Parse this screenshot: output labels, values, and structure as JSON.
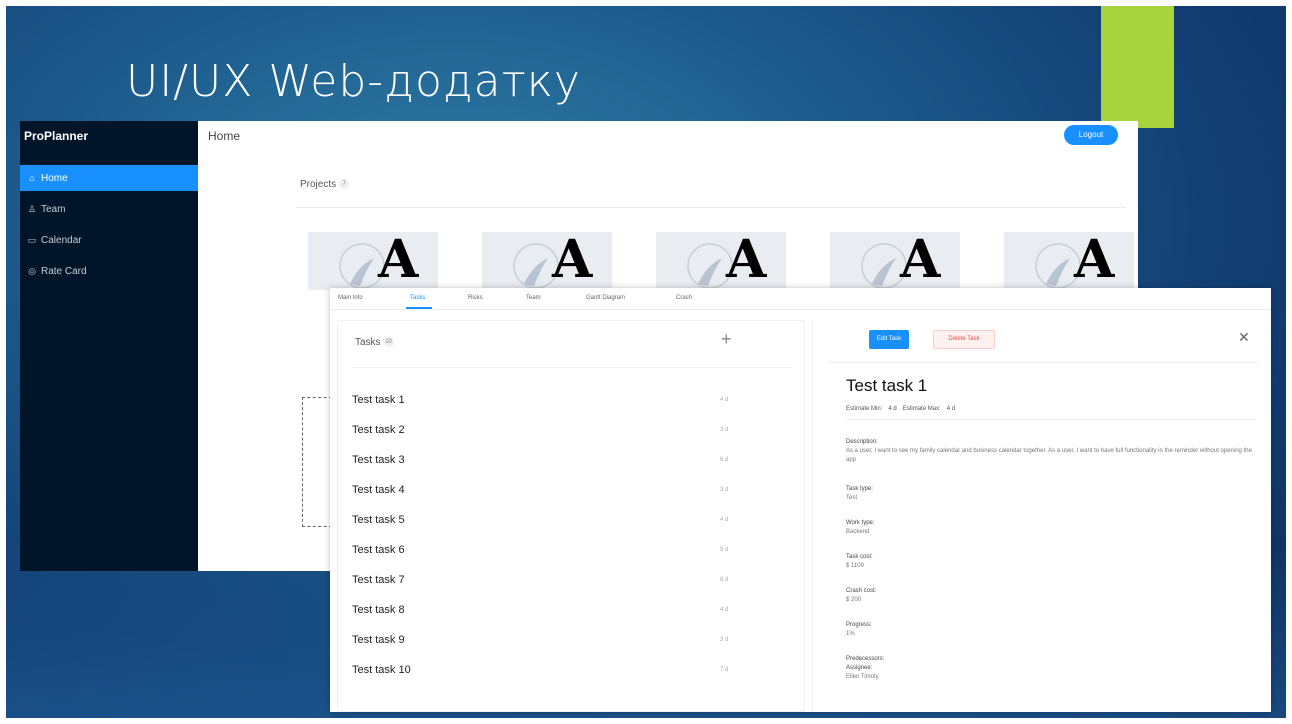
{
  "slide": {
    "title": "UI/UX Web-додатку",
    "accent_color": "#a9d33c"
  },
  "app": {
    "brand": "ProPlanner",
    "nav": [
      {
        "icon": "home-icon",
        "glyph": "⌂",
        "label": "Home",
        "active": true
      },
      {
        "icon": "team-icon",
        "glyph": "♙",
        "label": "Team",
        "active": false
      },
      {
        "icon": "calendar-icon",
        "glyph": "▭",
        "label": "Calendar",
        "active": false
      },
      {
        "icon": "rate-card-icon",
        "glyph": "◎",
        "label": "Rate Card",
        "active": false
      }
    ],
    "header_title": "Home",
    "logout_label": "Logout",
    "projects_label": "Projects",
    "projects_count": "7"
  },
  "detail_tabs": [
    "Main Info",
    "Tasks",
    "Risks",
    "Team",
    "Gantt Diagram",
    "Crash"
  ],
  "tasks": {
    "title": "Tasks",
    "count": "10",
    "items": [
      {
        "name": "Test task 1",
        "estimate": "4 d"
      },
      {
        "name": "Test task 2",
        "estimate": "3 d"
      },
      {
        "name": "Test task 3",
        "estimate": "6 d"
      },
      {
        "name": "Test task 4",
        "estimate": "3 d"
      },
      {
        "name": "Test task 5",
        "estimate": "4 d"
      },
      {
        "name": "Test task 6",
        "estimate": "5 d"
      },
      {
        "name": "Test task 7",
        "estimate": "8 d"
      },
      {
        "name": "Test task 8",
        "estimate": "4 d"
      },
      {
        "name": "Test task 9",
        "estimate": "3 d"
      },
      {
        "name": "Test task 10",
        "estimate": "7 d"
      }
    ]
  },
  "detail": {
    "edit_label": "Edit Task",
    "delete_label": "Delete Task",
    "title": "Test task 1",
    "estimate_min_label": "Estimate Min:",
    "estimate_min_value": "4 d",
    "estimate_max_label": "Estimate Max:",
    "estimate_max_value": "4 d",
    "description_label": "Description:",
    "description_value": "As a user, I want to see my family calendar and business calendar together. As a user, I want to have full functionality in the reminder without opening the app",
    "task_type_label": "Task type:",
    "task_type_value": "Test",
    "work_type_label": "Work type:",
    "work_type_value": "Backend",
    "task_cost_label": "Task cost:",
    "task_cost_value": "$ 1100",
    "crash_cost_label": "Crash cost:",
    "crash_cost_value": "$ 200",
    "progress_label": "Progress:",
    "progress_value": "1%",
    "predecessors_label": "Predecessors:",
    "assignee_label": "Assignee:",
    "assignee_value": "Ellen Timoty"
  }
}
